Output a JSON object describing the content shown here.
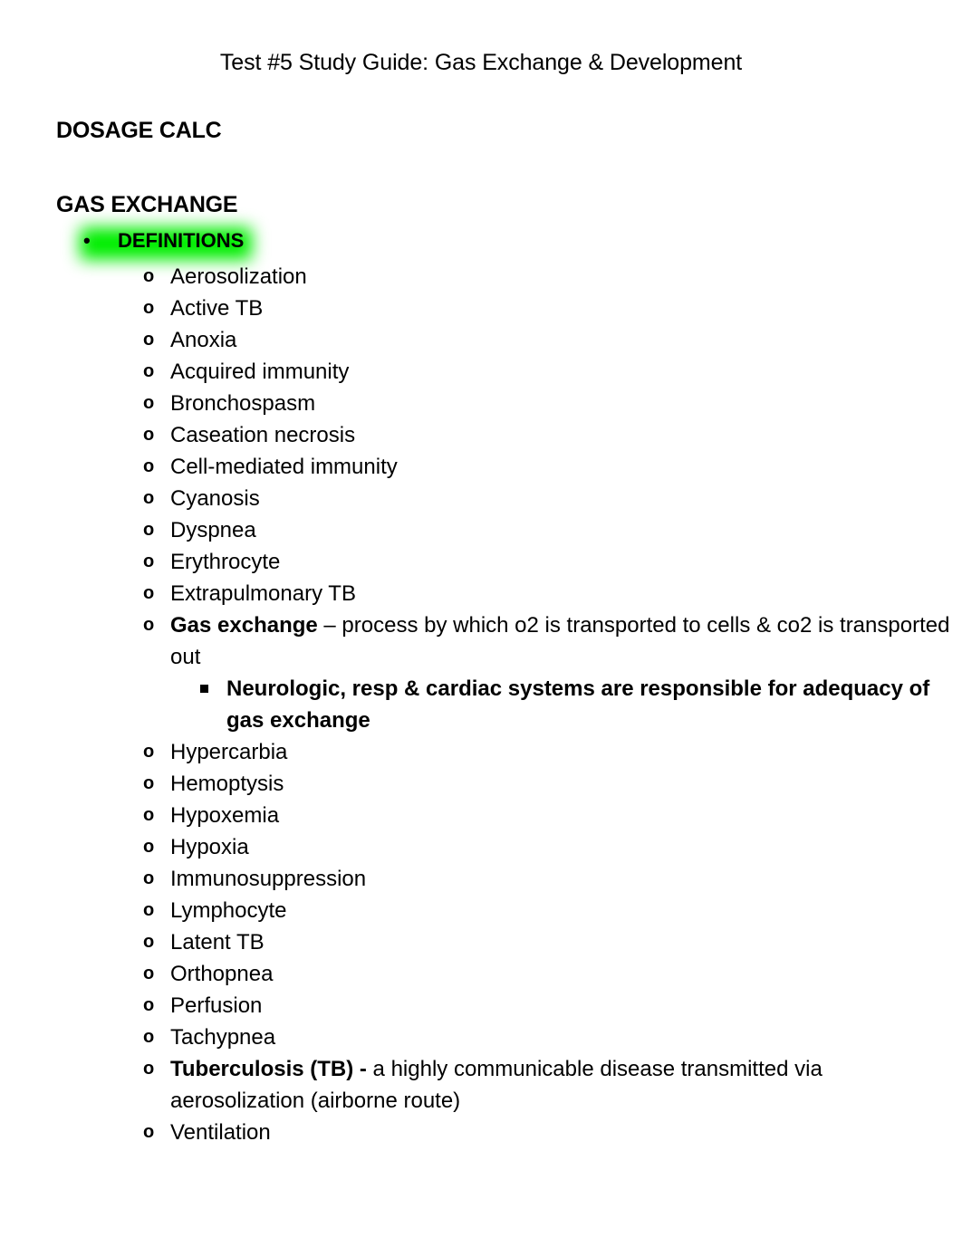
{
  "document": {
    "title": "Test #5 Study Guide: Gas Exchange & Development"
  },
  "colors": {
    "highlight_green": "#00ee00",
    "text": "#000000",
    "page_background": "#ffffff"
  },
  "headings": {
    "dosage_calc": "DOSAGE CALC",
    "gas_exchange": "GAS EXCHANGE"
  },
  "bullets": {
    "level1_marker": "•",
    "level2_marker": "o",
    "level3_marker": "square"
  },
  "definitions_heading": {
    "label": "DEFINITIONS",
    "highlighted": true,
    "highlight_color": "#00ee00"
  },
  "definitions": [
    {
      "level": 2,
      "term": "",
      "text": "Aerosolization"
    },
    {
      "level": 2,
      "term": "",
      "text": "Active TB"
    },
    {
      "level": 2,
      "term": "",
      "text": "Anoxia"
    },
    {
      "level": 2,
      "term": "",
      "text": "Acquired immunity"
    },
    {
      "level": 2,
      "term": "",
      "text": "Bronchospasm"
    },
    {
      "level": 2,
      "term": "",
      "text": "Caseation necrosis"
    },
    {
      "level": 2,
      "term": "",
      "text": "Cell-mediated immunity"
    },
    {
      "level": 2,
      "term": "",
      "text": "Cyanosis"
    },
    {
      "level": 2,
      "term": "",
      "text": "Dyspnea"
    },
    {
      "level": 2,
      "term": "",
      "text": "Erythrocyte"
    },
    {
      "level": 2,
      "term": "",
      "text": "Extrapulmonary TB"
    },
    {
      "level": 2,
      "term": "Gas exchange",
      "text": " – process by which o2 is transported to cells & co2 is transported out"
    },
    {
      "level": 3,
      "term": "",
      "text": "Neurologic, resp & cardiac systems are responsible for adequacy of gas exchange"
    },
    {
      "level": 2,
      "term": "",
      "text": "Hypercarbia"
    },
    {
      "level": 2,
      "term": "",
      "text": "Hemoptysis"
    },
    {
      "level": 2,
      "term": "",
      "text": "Hypoxemia"
    },
    {
      "level": 2,
      "term": "",
      "text": "Hypoxia"
    },
    {
      "level": 2,
      "term": "",
      "text": "Immunosuppression"
    },
    {
      "level": 2,
      "term": "",
      "text": "Lymphocyte"
    },
    {
      "level": 2,
      "term": "",
      "text": "Latent TB"
    },
    {
      "level": 2,
      "term": "",
      "text": "Orthopnea"
    },
    {
      "level": 2,
      "term": "",
      "text": "Perfusion"
    },
    {
      "level": 2,
      "term": "",
      "text": "Tachypnea"
    },
    {
      "level": 2,
      "term": "Tuberculosis (TB) -",
      "text": " a highly communicable disease transmitted via aerosolization (airborne route)"
    },
    {
      "level": 2,
      "term": "",
      "text": "Ventilation"
    }
  ]
}
